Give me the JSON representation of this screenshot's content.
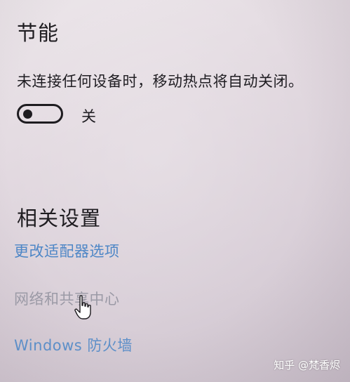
{
  "energy_saving": {
    "title": "节能",
    "description": "未连接任何设备时，移动热点将自动关闭。",
    "toggle_state": "关"
  },
  "related_settings": {
    "title": "相关设置",
    "links": [
      {
        "label": "更改适配器选项"
      },
      {
        "label": "网络和共享中心"
      },
      {
        "label": "Windows 防火墙"
      }
    ]
  },
  "watermark": "知乎 @梵香烬",
  "colors": {
    "link": "#4d86c6",
    "link_hover": "#9b9aa6",
    "text": "#1e1c20"
  }
}
